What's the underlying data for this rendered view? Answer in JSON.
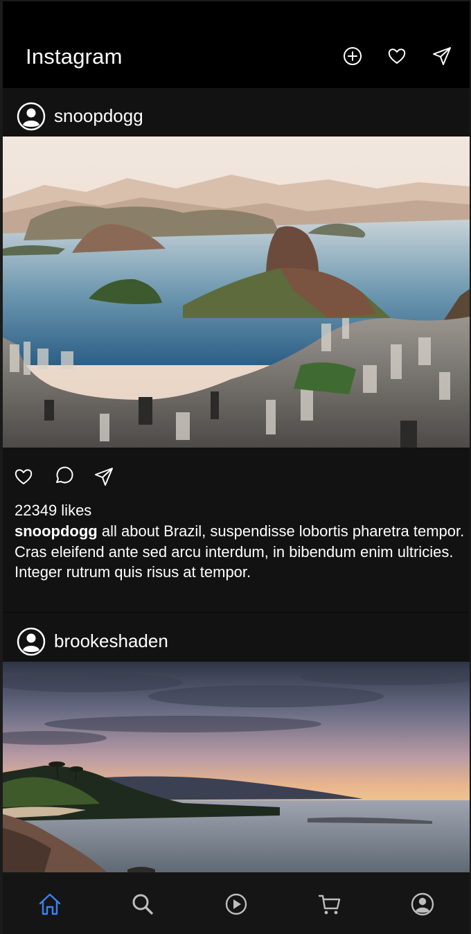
{
  "app": {
    "title": "Instagram"
  },
  "header": {
    "icons": [
      "add-circle-icon",
      "heart-icon",
      "send-icon"
    ]
  },
  "posts": [
    {
      "username": "snoopdogg",
      "image": "Aerial view of Rio de Janeiro bay with Sugarloaf Mountain",
      "likes_text": "22349 likes",
      "caption_user": "snoopdogg",
      "caption_text": " all about Brazil, suspendisse lobortis pharetra tempor. Cras eleifend ante sed arcu interdum, in bibendum enim ultricies. Integer rutrum quis risus at tempor."
    },
    {
      "username": "brookeshaden",
      "image": "Tropical coastline at sunset with palm trees and calm sea"
    }
  ],
  "tabs": [
    {
      "name": "home",
      "icon": "home-icon",
      "active": true
    },
    {
      "name": "search",
      "icon": "search-icon",
      "active": false
    },
    {
      "name": "reels",
      "icon": "play-icon",
      "active": false
    },
    {
      "name": "shop",
      "icon": "cart-icon",
      "active": false
    },
    {
      "name": "profile",
      "icon": "profile-icon",
      "active": false
    }
  ],
  "colors": {
    "background": "#121212",
    "header": "#000000",
    "active_tab": "#3b82f6",
    "icon": "#ffffff",
    "inactive_tab": "#bdbdbd"
  }
}
